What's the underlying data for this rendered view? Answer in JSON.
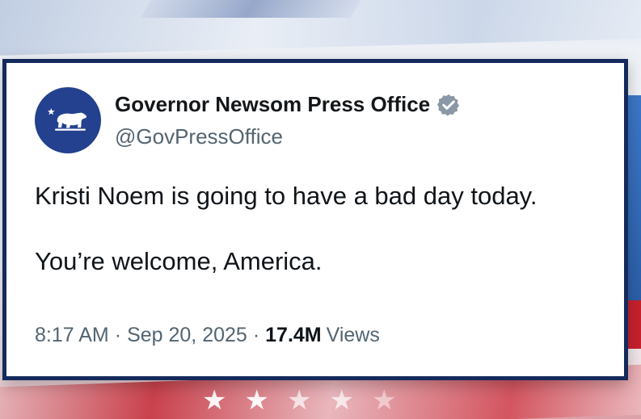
{
  "tweet": {
    "author_name": "Governor Newsom Press Office",
    "author_handle": "@GovPressOffice",
    "verified": true,
    "text_lines": [
      "Kristi Noem is going to have a bad day today.",
      "You’re welcome, America."
    ],
    "time": "8:17 AM",
    "separator": "·",
    "date": "Sep 20, 2025",
    "views_count": "17.4M",
    "views_label": "Views"
  },
  "avatar": {
    "icon": "california-bear-icon",
    "background_color": "#24418f"
  },
  "background": {
    "stars": [
      "★",
      "★",
      "★",
      "★",
      "★"
    ],
    "colors": {
      "border": "#152a5c",
      "accent_blue": "#2b5ea8",
      "accent_red": "#c8202d"
    }
  }
}
